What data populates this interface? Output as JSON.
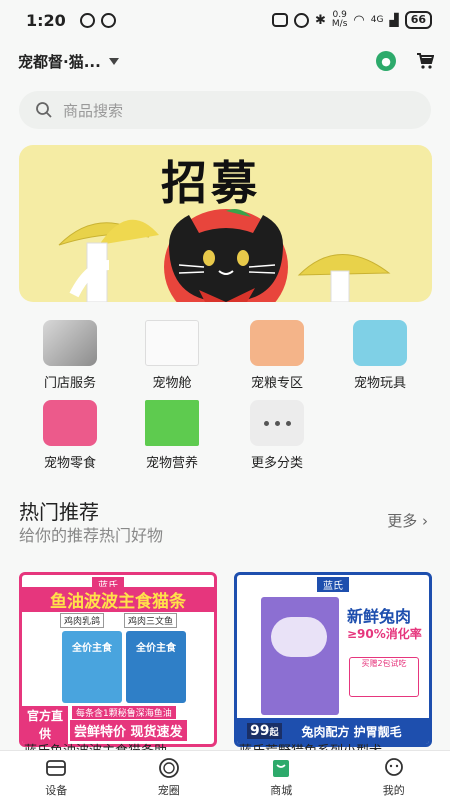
{
  "status_bar": {
    "time": "1:20",
    "net_speed_top": "0.9",
    "net_speed_bottom": "M/s",
    "signal_label": "4G",
    "battery": "66"
  },
  "header": {
    "store_name": "宠都督·猫...",
    "paw_icon": "paw-icon",
    "cart_icon": "cart-icon"
  },
  "search": {
    "placeholder": "商品搜索"
  },
  "banner": {
    "headline": "招募",
    "accent_color": "#f5eca4"
  },
  "categories": [
    {
      "label": "门店服务",
      "icon": "cat-photo-icon"
    },
    {
      "label": "宠物舱",
      "icon": "pet-cabin-icon"
    },
    {
      "label": "宠粮专区",
      "icon": "food-bowl-icon"
    },
    {
      "label": "宠物玩具",
      "icon": "toy-bowl-icon"
    },
    {
      "label": "宠物零食",
      "icon": "snack-pack-icon"
    },
    {
      "label": "宠物营养",
      "icon": "nutrition-bottle-icon"
    },
    {
      "label": "更多分类",
      "icon": "more-dots-icon"
    }
  ],
  "hot": {
    "title": "热门推荐",
    "subtitle": "给你的推荐热门好物",
    "more": "更多"
  },
  "products": [
    {
      "brand_tag": "蓝氏",
      "banner_text": "鱼油波波主食猫条",
      "sub_tag": "鸡肉乳鸽",
      "sub_tag2": "鸡肉三文鱼",
      "pack_text1": "全价主食",
      "pack_text2": "全价主食",
      "mid_text": "每条含1颗秘鲁深海鱼油",
      "badge": "官方直供",
      "promo": "尝鲜特价 现货速发",
      "name": "蓝氏鱼油波波主食猫条助"
    },
    {
      "brand_tag": "蓝氏",
      "headline": "新鲜兔肉",
      "rate": "≥90%消化率",
      "sample_label": "买赠2包试吃",
      "price": "99",
      "price_suffix": "起",
      "promo": "兔肉配方 护胃靓毛",
      "name": "蓝氏荒野猎兔系列小型犬"
    }
  ],
  "tabbar": [
    {
      "label": "设备",
      "icon": "device-icon"
    },
    {
      "label": "宠圈",
      "icon": "circle-icon"
    },
    {
      "label": "商城",
      "icon": "shop-bag-icon"
    },
    {
      "label": "我的",
      "icon": "profile-icon"
    }
  ],
  "colors": {
    "brand_green": "#2daa6b",
    "pink": "#e6367d",
    "blue": "#1e4fae"
  }
}
